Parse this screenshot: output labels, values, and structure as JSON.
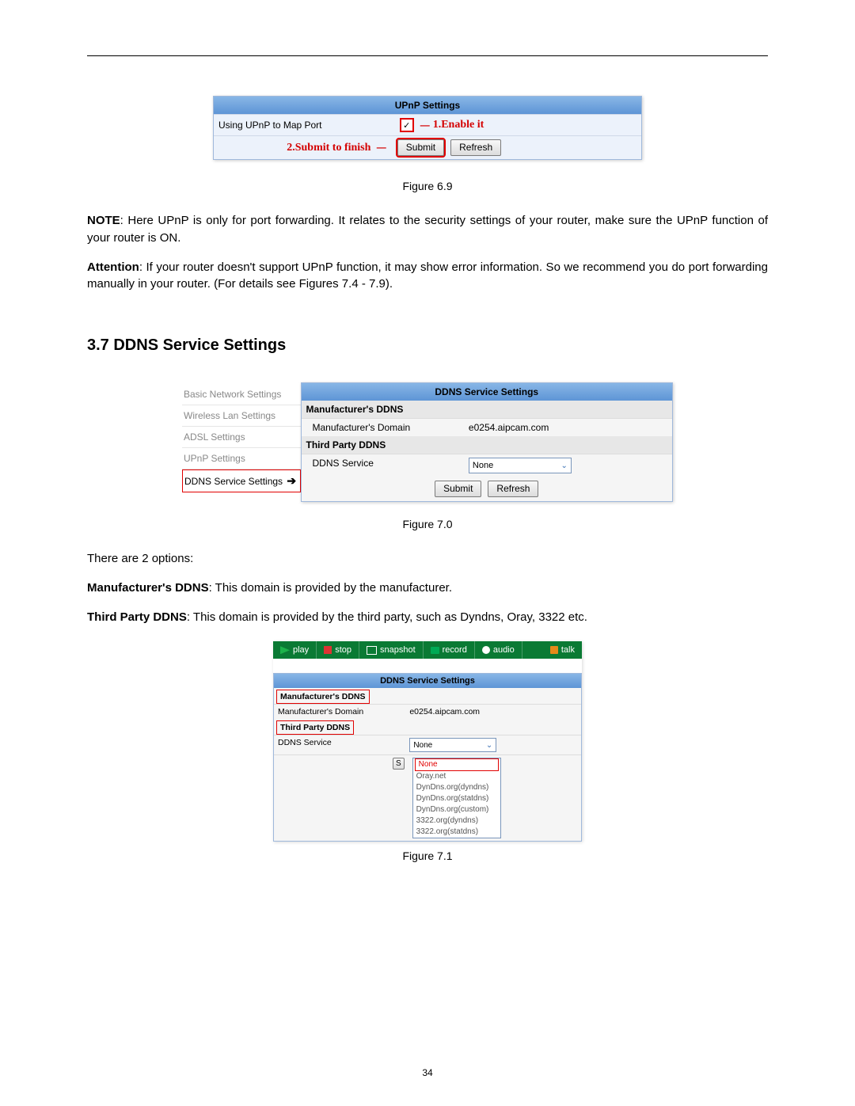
{
  "figure69": {
    "title": "UPnP Settings",
    "rowLabel": "Using UPnP to Map Port",
    "checkMark": "☑",
    "annotEnable": "1.Enable it",
    "annotSubmit": "2.Submit to finish",
    "submit": "Submit",
    "refresh": "Refresh",
    "caption": "Figure 6.9"
  },
  "noteLabel": "NOTE",
  "noteText": ": Here UPnP is only for port forwarding. It relates to the security settings of your router, make sure the UPnP function of your router is ON.",
  "attnLabel": "Attention",
  "attnText": ": If your router doesn't support UPnP function, it may show error information. So we recommend you do port forwarding manually in your router. (For details see Figures 7.4 - 7.9).",
  "sectionTitle": "3.7    DDNS Service Settings",
  "figure70": {
    "sidebar": [
      "Basic Network Settings",
      "Wireless Lan Settings",
      "ADSL Settings",
      "UPnP Settings",
      "DDNS Service Settings"
    ],
    "arrow": "➔",
    "header": "DDNS Service Settings",
    "mfgSection": "Manufacturer's DDNS",
    "mfgDomainLabel": "Manufacturer's Domain",
    "mfgDomainValue": "e0254.aipcam.com",
    "thirdSection": "Third Party DDNS",
    "ddnsServiceLabel": "DDNS Service",
    "ddnsValue": "None",
    "submit": "Submit",
    "refresh": "Refresh",
    "caption": "Figure 7.0"
  },
  "optsIntro": "There are 2 options:",
  "mfgDdnsLabel": "Manufacturer's DDNS",
  "mfgDdnsText": ": This domain is provided by the manufacturer.",
  "thirdDdnsLabel": "Third Party DDNS",
  "thirdDdnsText": ": This domain is provided by the third party, such as Dyndns, Oray, 3322 etc.",
  "figure71": {
    "toolbar": {
      "play": "play",
      "stop": "stop",
      "snapshot": "snapshot",
      "record": "record",
      "audio": "audio",
      "talk": "talk"
    },
    "header": "DDNS Service Settings",
    "mfgSection": "Manufacturer's DDNS",
    "mfgDomainLabel": "Manufacturer's Domain",
    "mfgDomainValue": "e0254.aipcam.com",
    "thirdSection": "Third Party DDNS",
    "ddnsServiceLabel": "DDNS Service",
    "ddnsValue": "None",
    "options": [
      "None",
      "Oray.net",
      "DynDns.org(dyndns)",
      "DynDns.org(statdns)",
      "DynDns.org(custom)",
      "3322.org(dyndns)",
      "3322.org(statdns)"
    ],
    "submitVisible": "S",
    "caption": "Figure 7.1"
  },
  "pageNumber": "34"
}
